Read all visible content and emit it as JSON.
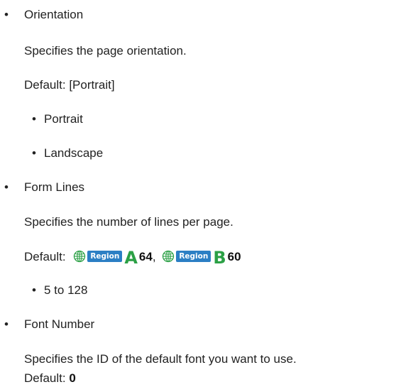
{
  "bullet_glyph": "•",
  "sections": [
    {
      "title": "Orientation",
      "description": "Specifies the page orientation.",
      "default_label": "Default:",
      "default_value": "[Portrait]",
      "options": [
        "Portrait",
        "Landscape"
      ]
    },
    {
      "title": "Form Lines",
      "description": "Specifies the number of lines per page.",
      "default_label": "Default:",
      "region_a": {
        "tag": "Region",
        "letter": "A",
        "value": "64"
      },
      "separator": ",",
      "region_b": {
        "tag": "Region",
        "letter": "B",
        "value": "60"
      },
      "options": [
        "5 to 128"
      ]
    },
    {
      "title": "Font Number",
      "description": "Specifies the ID of the default font you want to use.",
      "default_label": "Default:",
      "default_value": "0"
    }
  ],
  "colors": {
    "region_tag": "#2b7fc4",
    "region_letter": "#2ba045",
    "globe": "#2ba045"
  }
}
